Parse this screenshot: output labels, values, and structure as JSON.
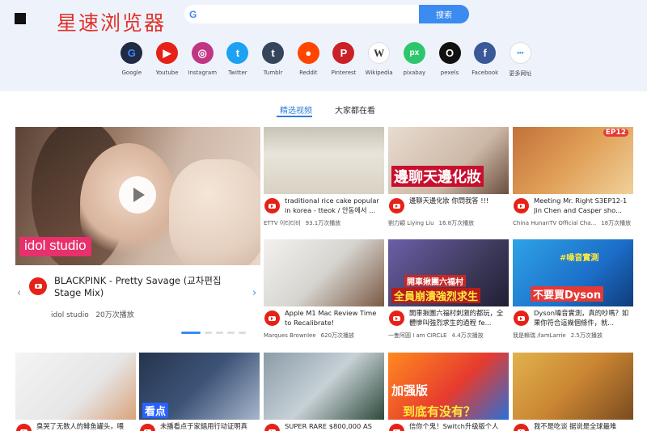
{
  "header": {
    "brand": "星速浏览器",
    "search_placeholder": "",
    "search_button": "搜索"
  },
  "sites": [
    {
      "label": "Google",
      "icon": "google-icon",
      "color": "#1f2a44",
      "glyph": "G"
    },
    {
      "label": "Youtube",
      "icon": "youtube-icon",
      "color": "#e62117",
      "glyph": "▶"
    },
    {
      "label": "Instagram",
      "icon": "instagram-icon",
      "color": "#c13584",
      "glyph": "◎"
    },
    {
      "label": "Twitter",
      "icon": "twitter-icon",
      "color": "#1da1f2",
      "glyph": "t"
    },
    {
      "label": "Tumblr",
      "icon": "tumblr-icon",
      "color": "#35465c",
      "glyph": "t"
    },
    {
      "label": "Reddit",
      "icon": "reddit-icon",
      "color": "#ff4500",
      "glyph": "●"
    },
    {
      "label": "Pinterest",
      "icon": "pinterest-icon",
      "color": "#cb2027",
      "glyph": "P"
    },
    {
      "label": "Wikipedia",
      "icon": "wikipedia-icon",
      "color": "#ffffff",
      "glyph": "W"
    },
    {
      "label": "pixabay",
      "icon": "pixabay-icon",
      "color": "#2ec66d",
      "glyph": "px"
    },
    {
      "label": "pexels",
      "icon": "pexels-icon",
      "color": "#111111",
      "glyph": "O"
    },
    {
      "label": "Facebook",
      "icon": "facebook-icon",
      "color": "#3b5998",
      "glyph": "f"
    },
    {
      "label": "更多网址",
      "icon": "more-icon",
      "color": "#ffffff",
      "glyph": "•••"
    }
  ],
  "tabs": [
    {
      "label": "精选视频",
      "active": true
    },
    {
      "label": "大家都在看",
      "active": false
    }
  ],
  "feature": {
    "tag": "idol studio",
    "title": "BLACKPINK - Pretty Savage (교차편집 Stage Mix)",
    "channel": "idol studio",
    "views": "20万次播放"
  },
  "cards": [
    {
      "title": "traditional rice cake popular in korea - tteok / 안동에서 ...",
      "channel": "ETTV 이티티비",
      "views": "93.1万次播放"
    },
    {
      "title": "邊聊天邊化妝 你問我答 !!!",
      "channel": "劉力穎 Liying Liu",
      "views": "16.8万次播放",
      "overlay": "邊聊天邊化妝"
    },
    {
      "title": "Meeting Mr. Right S3EP12-1 Jin Chen and Casper sho...",
      "channel": "China HunanTV Official Cha...",
      "views": "18万次播放",
      "overlay": "EP12"
    },
    {
      "title": "Apple M1 Mac Review Time to Recalibrate!",
      "channel": "Marques Brownlee",
      "views": "620万次播放"
    },
    {
      "title": "開車揪團六福村刺激的都玩，全體慘叫強烈求生的過程 fe...",
      "channel": "一隻阿圓 I am CIRCLE",
      "views": "4.4万次播放",
      "overlay": "開車揪團六福村",
      "overlay2": "全員崩潰強烈求生"
    },
    {
      "title": "Dyson噪音實測，真的吵嗎？如果你符合這幾個條件，就...",
      "channel": "我是賴瑞 /lamLarrie",
      "views": "2.5万次播放",
      "overlay": "#噪音實測",
      "overlay2": "不要買Dyson"
    },
    {
      "title": "臭哭了无数人的鲱鱼罐头，喂"
    },
    {
      "title": "未播看点于家錩用行动证明真",
      "overlay": "看点"
    },
    {
      "title": "SUPER RARE $800,000 AS"
    },
    {
      "title": "信你个鬼！Switch升级版个人",
      "overlay": "加强版",
      "overlay2": "到底有没有？"
    },
    {
      "title": "我不是吃谈 据说是全球最难"
    }
  ]
}
